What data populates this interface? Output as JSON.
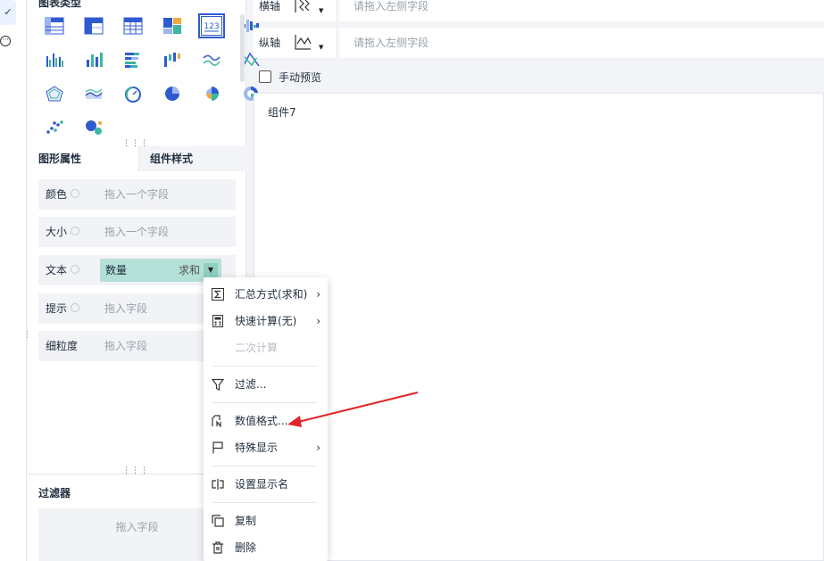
{
  "left_rail": {
    "check_icon": "check-icon",
    "more_icon": "more-circle-icon"
  },
  "chart_types": {
    "title": "图表类型",
    "icons": [
      "table-icon",
      "cross-table-icon",
      "detail-table-icon",
      "treemap-icon",
      "kpi-number-icon",
      "dot-bar-icon",
      "grouped-bar-icon",
      "column-bar-icon",
      "stacked-horizontal-bar-icon",
      "waterfall-bar-icon",
      "line-icon",
      "radar-lines-icon",
      "radar-icon",
      "area-icon",
      "gauge-icon",
      "pie-icon",
      "rose-pie-icon",
      "donut-icon",
      "scatter-icon",
      "bubble-icon"
    ],
    "selected_index": 4,
    "kpi_text": "123"
  },
  "tabs": {
    "graphic_props": "图形属性",
    "component_style": "组件样式"
  },
  "props": {
    "color": {
      "label": "颜色",
      "placeholder": "拖入一个字段"
    },
    "size": {
      "label": "大小",
      "placeholder": "拖入一个字段"
    },
    "text": {
      "label": "文本",
      "field_name": "数量",
      "field_agg": "求和"
    },
    "tooltip": {
      "label": "提示",
      "placeholder": "拖入字段"
    },
    "granularity": {
      "label": "细粒度",
      "placeholder": "拖入字段"
    }
  },
  "filter": {
    "title": "过滤器",
    "placeholder": "拖入字段"
  },
  "axes": {
    "x_label": "横轴",
    "x_placeholder": "请拖入左侧字段",
    "y_label": "纵轴",
    "y_placeholder": "请拖入左侧字段"
  },
  "manual_preview": "手动预览",
  "component_title": "组件7",
  "context_menu": {
    "items": [
      {
        "label": "汇总方式(求和)",
        "icon": "sigma-icon",
        "submenu": true,
        "disabled": false
      },
      {
        "label": "快速计算(无)",
        "icon": "calculator-icon",
        "submenu": true,
        "disabled": false
      },
      {
        "label": "二次计算",
        "icon": "",
        "submenu": false,
        "disabled": true
      },
      {
        "label": "过滤...",
        "icon": "filter-icon",
        "submenu": false,
        "disabled": false
      },
      {
        "label": "数值格式...",
        "icon": "number-format-icon",
        "submenu": false,
        "disabled": false
      },
      {
        "label": "特殊显示",
        "icon": "flag-icon",
        "submenu": true,
        "disabled": false
      },
      {
        "label": "设置显示名",
        "icon": "rename-icon",
        "submenu": false,
        "disabled": false
      },
      {
        "label": "复制",
        "icon": "copy-icon",
        "submenu": false,
        "disabled": false
      },
      {
        "label": "删除",
        "icon": "delete-icon",
        "submenu": false,
        "disabled": false
      }
    ],
    "arrow_glyph": "›"
  },
  "colors": {
    "accent_blue": "#2f5bd1",
    "teal": "#3bb6a3",
    "pill": "#b4e0d7",
    "annotation_arrow": "#e0262a"
  }
}
